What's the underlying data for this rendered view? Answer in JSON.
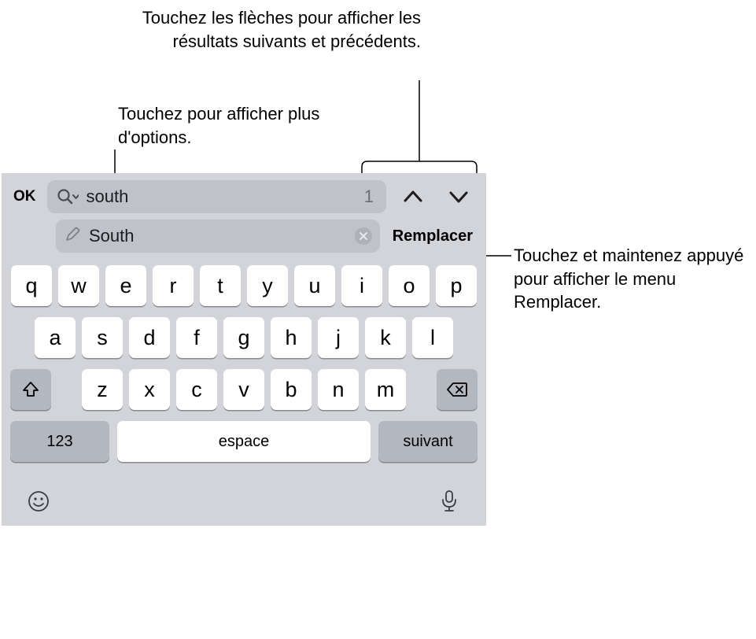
{
  "callouts": {
    "arrows": "Touchez les flèches pour afficher les résultats suivants et précédents.",
    "options": "Touchez pour afficher plus d'options.",
    "replaceHold": "Touchez et maintenez appuyé pour afficher le menu Remplacer."
  },
  "findbar": {
    "ok": "OK",
    "searchValue": "south",
    "matchCount": "1",
    "replaceValue": "South",
    "replaceButton": "Remplacer"
  },
  "keyboard": {
    "row1": [
      "q",
      "w",
      "e",
      "r",
      "t",
      "y",
      "u",
      "i",
      "o",
      "p"
    ],
    "row2": [
      "a",
      "s",
      "d",
      "f",
      "g",
      "h",
      "j",
      "k",
      "l"
    ],
    "row3": [
      "z",
      "x",
      "c",
      "v",
      "b",
      "n",
      "m"
    ],
    "numKey": "123",
    "spaceKey": "espace",
    "nextKey": "suivant"
  }
}
